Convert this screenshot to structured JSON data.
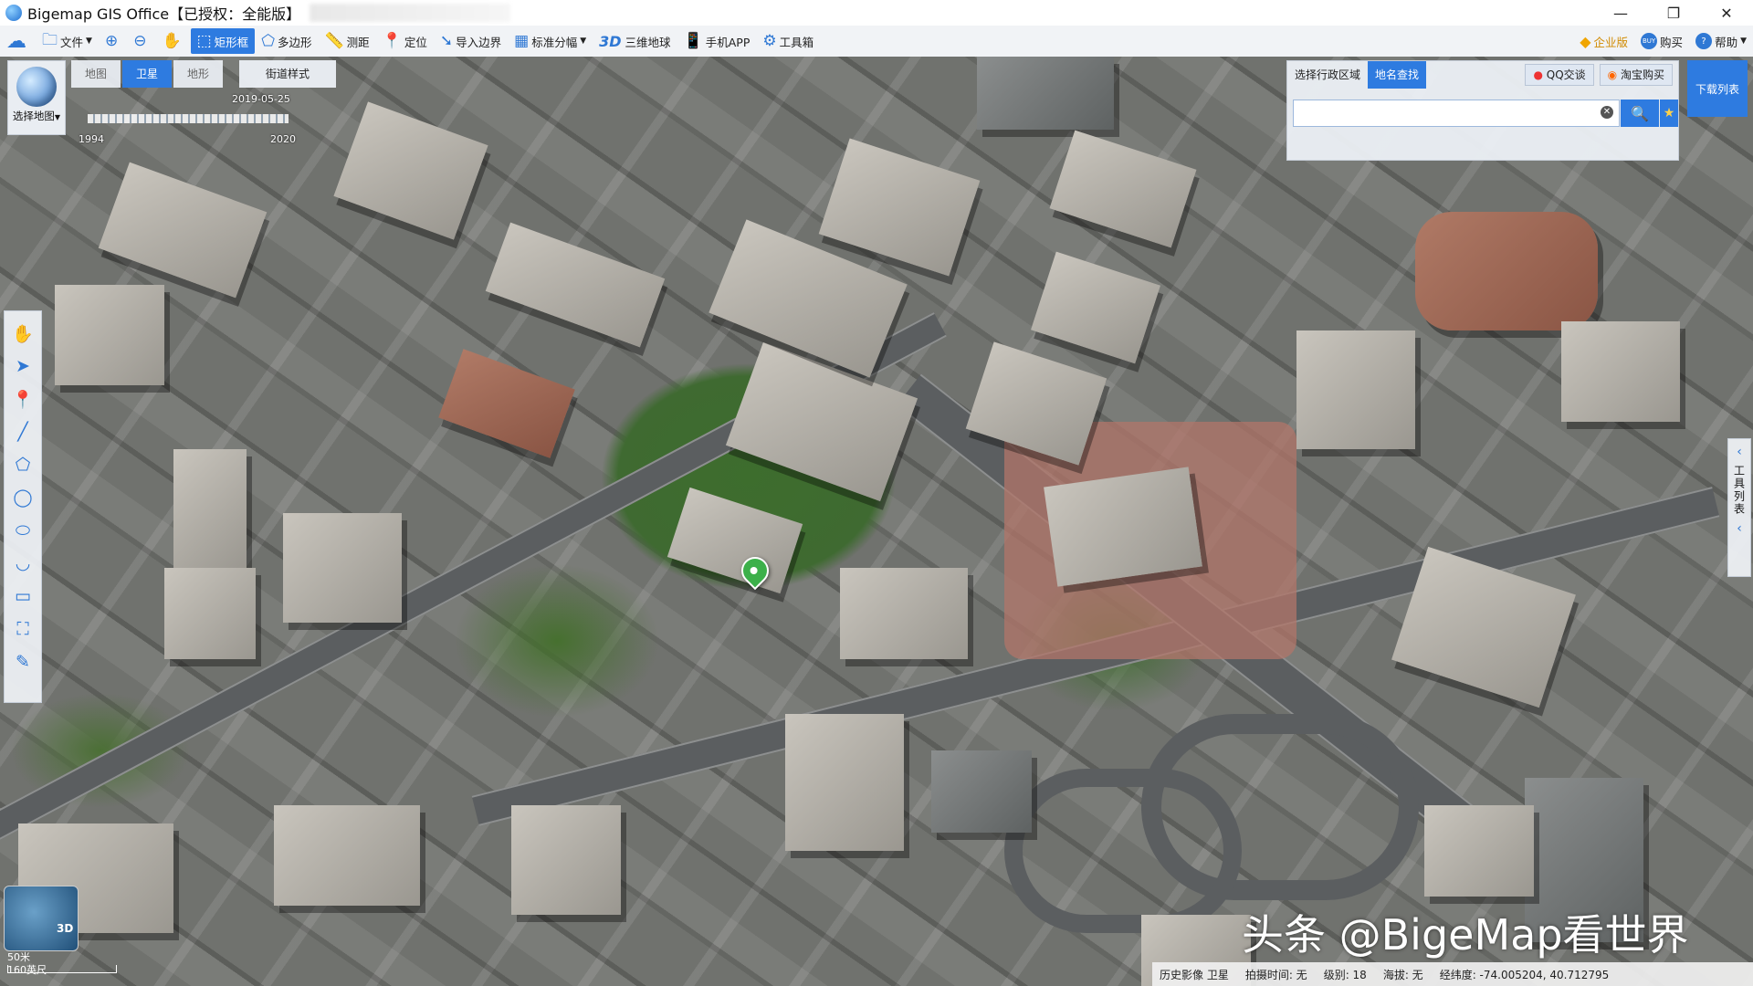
{
  "window": {
    "title": "Bigemap GIS Office【已授权：全能版】",
    "controls": {
      "minimize": "—",
      "restore": "❐",
      "close": "✕"
    }
  },
  "toolbar": {
    "items": [
      {
        "label": "文件",
        "icon": "folder-icon",
        "glyph": "🗀"
      },
      {
        "label": "",
        "icon": "zoom-in-icon",
        "glyph": "⊕"
      },
      {
        "label": "",
        "icon": "zoom-out-icon",
        "glyph": "⊖"
      },
      {
        "label": "",
        "icon": "hand-pan-icon",
        "glyph": "✋"
      },
      {
        "label": "矩形框",
        "icon": "rectangle-select-icon",
        "glyph": "⬚",
        "active": true
      },
      {
        "label": "多边形",
        "icon": "polygon-icon",
        "glyph": "⬠"
      },
      {
        "label": "测距",
        "icon": "ruler-icon",
        "glyph": "📏"
      },
      {
        "label": "定位",
        "icon": "location-pin-icon",
        "glyph": "📍"
      },
      {
        "label": "导入边界",
        "icon": "import-boundary-icon",
        "glyph": "➘"
      },
      {
        "label": "标准分幅",
        "icon": "grid-icon",
        "glyph": "▦"
      },
      {
        "label": "三维地球",
        "icon": "3d-globe-icon",
        "glyph": "3D"
      },
      {
        "label": "手机APP",
        "icon": "phone-icon",
        "glyph": "📱"
      },
      {
        "label": "工具箱",
        "icon": "gear-icon",
        "glyph": "⚙"
      }
    ],
    "right": {
      "enterprise": "企业版",
      "buy": "购买",
      "buy_badge": "BUY",
      "help": "帮助",
      "help_badge": "?"
    }
  },
  "map_controls": {
    "select_map": "选择地图",
    "tabs": [
      {
        "label": "地图",
        "active": false
      },
      {
        "label": "卫星",
        "active": true
      },
      {
        "label": "地形",
        "active": false
      }
    ],
    "street_style": "街道样式",
    "timeline": {
      "current": "2019-05-25",
      "start": "1994",
      "end": "2020"
    }
  },
  "search_panel": {
    "tabs": [
      {
        "label": "选择行政区域",
        "active": false
      },
      {
        "label": "地名查找",
        "active": true
      }
    ],
    "qq_button": "QQ交谈",
    "taobao_button": "淘宝购买",
    "search_value": "",
    "clear": "✕",
    "search_icon": "🔍",
    "favorite_icon": "★"
  },
  "download_list": "下载列表",
  "right_tools": {
    "label": "工具列表",
    "arrow_left": "‹",
    "arrow_collapse": "‹"
  },
  "left_tools": [
    {
      "name": "hand-icon",
      "glyph": "✋"
    },
    {
      "name": "pointer-icon",
      "glyph": "➤"
    },
    {
      "name": "marker-icon",
      "glyph": "📍"
    },
    {
      "name": "line-icon",
      "glyph": "╱"
    },
    {
      "name": "polygon-draw-icon",
      "glyph": "⬠"
    },
    {
      "name": "circle-icon",
      "glyph": "◯"
    },
    {
      "name": "ellipse-icon",
      "glyph": "⬭"
    },
    {
      "name": "curve-icon",
      "glyph": "◡"
    },
    {
      "name": "rectangle-icon",
      "glyph": "▭"
    },
    {
      "name": "measure-area-icon",
      "glyph": "⛶"
    },
    {
      "name": "edit-shape-icon",
      "glyph": "✎"
    }
  ],
  "scale": {
    "line1": "50米",
    "line2": "160英尺"
  },
  "minimap_badge": "3D",
  "watermark": "头条 @BigeMap看世界",
  "status": {
    "history": "历史影像 卫星",
    "capture_time": "拍摄时间: 无",
    "level": "级别: 18",
    "altitude": "海拔: 无",
    "coordinates": "经纬度: -74.005204, 40.712795"
  }
}
